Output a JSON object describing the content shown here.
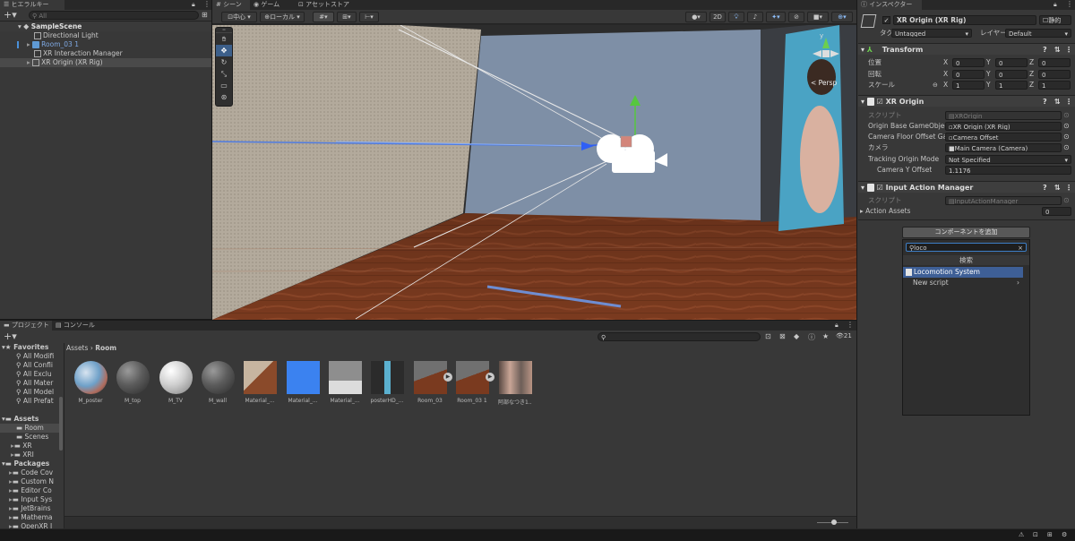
{
  "hierarchy": {
    "tab": "ヒエラルキー",
    "search_placeholder": "All",
    "scene": "SampleScene",
    "items": [
      "Directional Light",
      "Room_03 1",
      "XR Interaction Manager",
      "XR Origin (XR Rig)"
    ]
  },
  "scene_tabs": {
    "scene": "シーン",
    "game": "ゲーム",
    "asset_store": "アセットストア"
  },
  "scene_toolbar": {
    "pivot": "中心",
    "space": "ローカル",
    "mode_2d": "2D"
  },
  "scene_view": {
    "persp": "< Persp",
    "gizmo_y": "y"
  },
  "project": {
    "tab_project": "プロジェクト",
    "tab_console": "コンソール",
    "breadcrumb_root": "Assets",
    "breadcrumb_current": "Room",
    "hidden_count": "21",
    "favorites_label": "Favorites",
    "favorites": [
      "All Modifi",
      "All Confli",
      "All Exclu",
      "All Mater",
      "All Model",
      "All Prefat"
    ],
    "assets_label": "Assets",
    "asset_folders": [
      "Room",
      "Scenes",
      "XR",
      "XRI"
    ],
    "packages_label": "Packages",
    "packages": [
      "Code Cov",
      "Custom N",
      "Editor Co",
      "Input Sys",
      "JetBrains",
      "Mathema",
      "OpenXR I"
    ],
    "assets": [
      {
        "name": "M_poster",
        "kind": "sphere-poster"
      },
      {
        "name": "M_top",
        "kind": "sphere-dark"
      },
      {
        "name": "M_TV",
        "kind": "sphere-light"
      },
      {
        "name": "M_wall",
        "kind": "sphere-dark"
      },
      {
        "name": "Material_...",
        "kind": "wood-tex"
      },
      {
        "name": "Material_...",
        "kind": "blue-tex"
      },
      {
        "name": "Material_...",
        "kind": "grey-tex"
      },
      {
        "name": "posterHD_...",
        "kind": "poster-tex"
      },
      {
        "name": "Room_03",
        "kind": "room-prefab"
      },
      {
        "name": "Room_03 1",
        "kind": "room-prefab"
      },
      {
        "name": "阿部なつき1...",
        "kind": "photo-tex"
      }
    ]
  },
  "inspector": {
    "tab": "インスペクター",
    "object_name": "XR Origin (XR Rig)",
    "static_label": "静的",
    "tag_label": "タグ",
    "tag_value": "Untagged",
    "layer_label": "レイヤー",
    "layer_value": "Default",
    "transform": {
      "title": "Transform",
      "position_label": "位置",
      "rotation_label": "回転",
      "scale_label": "スケール",
      "position": [
        "0",
        "0",
        "0"
      ],
      "rotation": [
        "0",
        "0",
        "0"
      ],
      "scale": [
        "1",
        "1",
        "1"
      ],
      "axes": [
        "X",
        "Y",
        "Z"
      ]
    },
    "xr_origin": {
      "title": "XR Origin",
      "script_label": "スクリプト",
      "script_value": "XROrigin",
      "origin_label": "Origin Base GameObjec",
      "origin_value": "XR Origin (XR Rig)",
      "floor_label": "Camera Floor Offset Ga",
      "floor_value": "Camera Offset",
      "camera_label": "カメラ",
      "camera_value": "Main Camera (Camera)",
      "tracking_label": "Tracking Origin Mode",
      "tracking_value": "Not Specified",
      "cam_y_label": "Camera Y Offset",
      "cam_y_value": "1.1176"
    },
    "input_action": {
      "title": "Input Action Manager",
      "script_label": "スクリプト",
      "script_value": "InputActionManager",
      "action_assets_label": "Action Assets",
      "action_assets_value": "0"
    },
    "add_component_label": "コンポーネントを追加",
    "popup": {
      "search_value": "loco",
      "header": "検索",
      "result_1": "Locomotion System",
      "result_2": "New script"
    }
  },
  "colors": {
    "accent": "#2c5d87",
    "selection": "#3e5f96",
    "panel": "#383838",
    "dark": "#282828",
    "scene_sky": "#7d8ea5"
  }
}
